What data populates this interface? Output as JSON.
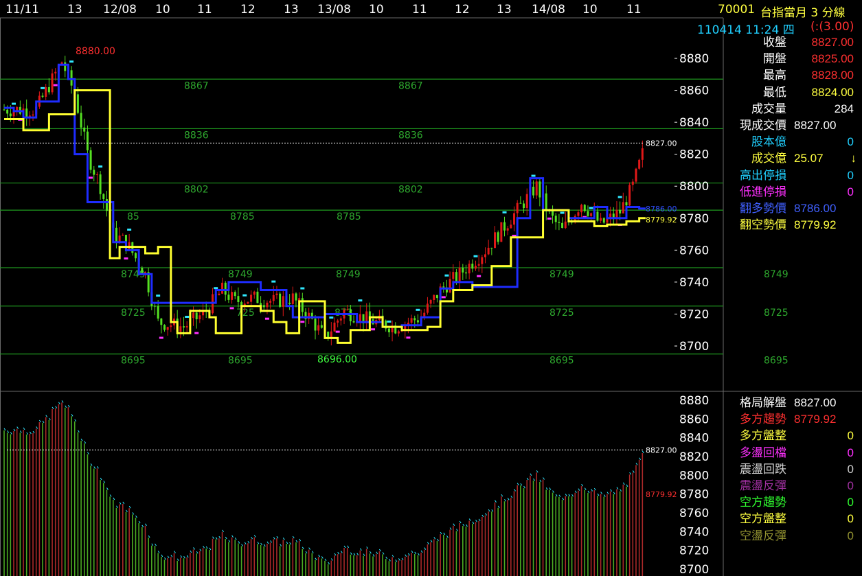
{
  "header": {
    "symbol": "70001",
    "name": "台指當月 3 分線",
    "datetime": "110414 11:24 四",
    "change": "(:(3.00)"
  },
  "quote": [
    {
      "label": "收盤",
      "value": "8827.00",
      "lc": "#ffffff",
      "vc": "#ff3030"
    },
    {
      "label": "開盤",
      "value": "8825.00",
      "lc": "#ffffff",
      "vc": "#ff3030"
    },
    {
      "label": "最高",
      "value": "8828.00",
      "lc": "#ffffff",
      "vc": "#ff3030"
    },
    {
      "label": "最低",
      "value": "8824.00",
      "lc": "#ffffff",
      "vc": "#ffff40"
    },
    {
      "label": "成交量",
      "value": "284",
      "lc": "#ffffff",
      "vc": "#ffffff"
    },
    {
      "label": "現成交價",
      "value": "8827.00",
      "lc": "#ffffff",
      "vc": "#ffffff"
    },
    {
      "label": "股本億",
      "value": "0",
      "lc": "#20d0ff",
      "vc": "#20d0ff"
    },
    {
      "label": "成交億",
      "value": "25.07",
      "lc": "#ffff40",
      "vc": "#ffff40",
      "extra": "↓"
    },
    {
      "label": "高出停損",
      "value": "0",
      "lc": "#20d0ff",
      "vc": "#20d0ff"
    },
    {
      "label": "低進停損",
      "value": "0",
      "lc": "#ff30ff",
      "vc": "#ff30ff"
    },
    {
      "label": "翻多勢價",
      "value": "8786.00",
      "lc": "#4060ff",
      "vc": "#4060ff"
    },
    {
      "label": "翻空勢價",
      "value": "8779.92",
      "lc": "#ffff40",
      "vc": "#ffff40"
    }
  ],
  "status": [
    {
      "label": "格局解盤",
      "value": "8827.00",
      "lc": "#ffffff",
      "vc": "#ffffff"
    },
    {
      "label": "多方趨勢",
      "value": "8779.92",
      "lc": "#ff3030",
      "vc": "#ff3030"
    },
    {
      "label": "多方盤整",
      "value": "0",
      "lc": "#ffff40",
      "vc": "#ffff40"
    },
    {
      "label": "多盪回檔",
      "value": "0",
      "lc": "#ff30ff",
      "vc": "#ff30ff"
    },
    {
      "label": "震盪回跌",
      "value": "0",
      "lc": "#d0d0d0",
      "vc": "#d0d0d0"
    },
    {
      "label": "震盪反彈",
      "value": "0",
      "lc": "#a030a0",
      "vc": "#a030a0"
    },
    {
      "label": "空方趨勢",
      "value": "0",
      "lc": "#30ff30",
      "vc": "#30ff30"
    },
    {
      "label": "空方盤整",
      "value": "0",
      "lc": "#ffff40",
      "vc": "#ffff40"
    },
    {
      "label": "空盪反彈",
      "value": "0",
      "lc": "#909030",
      "vc": "#909030"
    }
  ],
  "chart_data": {
    "type": "line",
    "x_ticks": [
      "11/11",
      "13",
      "12/08",
      "10",
      "11",
      "12",
      "13",
      "13/08",
      "10",
      "11",
      "12",
      "13",
      "14/08",
      "10",
      "11"
    ],
    "y_ticks": [
      8700,
      8720,
      8740,
      8760,
      8780,
      8800,
      8820,
      8840,
      8860,
      8880
    ],
    "ylim": [
      8685,
      8895
    ],
    "lower_y_ticks": [
      8700,
      8720,
      8740,
      8760,
      8780,
      8800,
      8820,
      8840,
      8860,
      8880
    ],
    "lower_ylim": [
      8697,
      8890
    ],
    "last_price": 8827.0,
    "last_price_label": "8827.00",
    "flip_long_label": "8786.00",
    "flip_short_label": "8779.92",
    "high_label": "8880.00",
    "low_label": "8696.00",
    "levels": [
      {
        "price": 8867,
        "labels": [
          "8867",
          "8867"
        ]
      },
      {
        "price": 8836,
        "labels": [
          "8836",
          "8836"
        ]
      },
      {
        "price": 8802,
        "labels": [
          "8802",
          "8802"
        ]
      },
      {
        "price": 8785,
        "labels": [
          "85",
          "8785",
          "8785"
        ]
      },
      {
        "price": 8749,
        "labels": [
          "8749",
          "8749",
          "8749",
          "8749",
          "8749"
        ]
      },
      {
        "price": 8725,
        "labels": [
          "8725",
          "725",
          "873",
          "8725",
          "8725"
        ]
      },
      {
        "price": 8695,
        "labels": [
          "8695",
          "8695",
          "8695",
          "8695"
        ]
      }
    ],
    "series": [
      {
        "name": "翻多勢價",
        "color": "#1e2cff",
        "points": [
          [
            0,
            8849
          ],
          [
            1,
            8849
          ],
          [
            3,
            8847
          ],
          [
            6,
            8843
          ],
          [
            10,
            8853
          ],
          [
            14,
            8853
          ],
          [
            17,
            8876
          ],
          [
            20,
            8867
          ],
          [
            22,
            8820
          ],
          [
            26,
            8790
          ],
          [
            30,
            8790
          ],
          [
            34,
            8765
          ],
          [
            38,
            8760
          ],
          [
            42,
            8745
          ],
          [
            46,
            8727
          ],
          [
            60,
            8727
          ],
          [
            66,
            8735
          ],
          [
            70,
            8740
          ],
          [
            80,
            8735
          ],
          [
            88,
            8725
          ],
          [
            90,
            8718
          ],
          [
            100,
            8720
          ],
          [
            110,
            8715
          ],
          [
            118,
            8712
          ],
          [
            124,
            8713
          ],
          [
            130,
            8718
          ],
          [
            136,
            8736
          ],
          [
            140,
            8740
          ],
          [
            146,
            8737
          ],
          [
            156,
            8737
          ],
          [
            160,
            8780
          ],
          [
            164,
            8805
          ],
          [
            168,
            8785
          ],
          [
            172,
            8785
          ],
          [
            176,
            8780
          ],
          [
            184,
            8787
          ],
          [
            188,
            8780
          ],
          [
            194,
            8787
          ],
          [
            198,
            8786
          ],
          [
            200,
            8786
          ]
        ]
      },
      {
        "name": "翻空勢價",
        "color": "#ffff30",
        "points": [
          [
            0,
            8842
          ],
          [
            4,
            8842
          ],
          [
            6,
            8835
          ],
          [
            12,
            8835
          ],
          [
            14,
            8845
          ],
          [
            18,
            8845
          ],
          [
            22,
            8860
          ],
          [
            32,
            8860
          ],
          [
            33,
            8755
          ],
          [
            36,
            8762
          ],
          [
            40,
            8762
          ],
          [
            44,
            8758
          ],
          [
            48,
            8762
          ],
          [
            52,
            8715
          ],
          [
            54,
            8708
          ],
          [
            58,
            8722
          ],
          [
            64,
            8718
          ],
          [
            66,
            8708
          ],
          [
            70,
            8708
          ],
          [
            74,
            8725
          ],
          [
            80,
            8722
          ],
          [
            84,
            8715
          ],
          [
            88,
            8708
          ],
          [
            92,
            8728
          ],
          [
            100,
            8705
          ],
          [
            104,
            8702
          ],
          [
            108,
            8710
          ],
          [
            114,
            8718
          ],
          [
            118,
            8712
          ],
          [
            124,
            8710
          ],
          [
            132,
            8712
          ],
          [
            136,
            8728
          ],
          [
            140,
            8735
          ],
          [
            146,
            8738
          ],
          [
            152,
            8750
          ],
          [
            158,
            8768
          ],
          [
            164,
            8768
          ],
          [
            168,
            8785
          ],
          [
            174,
            8785
          ],
          [
            176,
            8778
          ],
          [
            184,
            8775
          ],
          [
            188,
            8776
          ],
          [
            194,
            8778
          ],
          [
            198,
            8780
          ],
          [
            200,
            8780
          ]
        ]
      }
    ]
  }
}
